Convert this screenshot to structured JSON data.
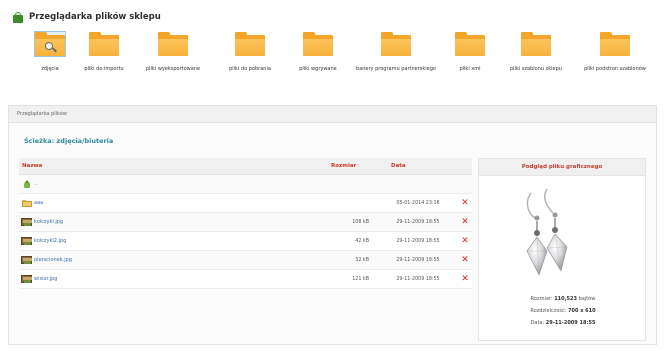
{
  "header": {
    "title": "Przeglądarka plików sklepu"
  },
  "folders": [
    {
      "label": "zdjęcia",
      "active": true
    },
    {
      "label": "pliki do importu",
      "active": false
    },
    {
      "label": "pliki wyeksportowane",
      "active": false
    },
    {
      "label": "pliki do pobrania",
      "active": false
    },
    {
      "label": "pliki wgrywane",
      "active": false
    },
    {
      "label": "banery programu partnerskiego",
      "active": false
    },
    {
      "label": "pliki xml",
      "active": false
    },
    {
      "label": "pliki szablonu sklepu",
      "active": false
    },
    {
      "label": "pliki podstron szablonów",
      "active": false
    }
  ],
  "panel": {
    "title": "Przeglądarka plików",
    "breadcrumb": "Ścieżka: zdjęcia/biuteria"
  },
  "table": {
    "headers": {
      "name": "Nazwa",
      "size": "Rozmiar",
      "date": "Data"
    },
    "rows": [
      {
        "type": "up",
        "name": "..",
        "size": "",
        "date": "",
        "deletable": false
      },
      {
        "type": "dir",
        "name": "aaa",
        "size": "",
        "date": "05-01-2014 23:16",
        "deletable": true
      },
      {
        "type": "img",
        "name": "kolczyki.jpg",
        "size": "108 kB",
        "date": "29-11-2009 18:55",
        "deletable": true
      },
      {
        "type": "img",
        "name": "kolczyki2.jpg",
        "size": "42 kB",
        "date": "29-11-2009 18:55",
        "deletable": true
      },
      {
        "type": "img",
        "name": "pierscionek.jpg",
        "size": "32 kB",
        "date": "29-11-2009 18:55",
        "deletable": true
      },
      {
        "type": "img",
        "name": "wisior.jpg",
        "size": "121 kB",
        "date": "29-11-2009 18:55",
        "deletable": true
      }
    ],
    "delete_glyph": "✕"
  },
  "preview": {
    "title": "Podgląd pliku graficznego",
    "size_label": "Rozmiar:",
    "size_value": "110,523",
    "size_unit": "bajtów",
    "resolution_label": "Rozdzielczość:",
    "resolution_value": "700 x 610",
    "date_label": "Data:",
    "date_value": "29-11-2009 18:55"
  }
}
